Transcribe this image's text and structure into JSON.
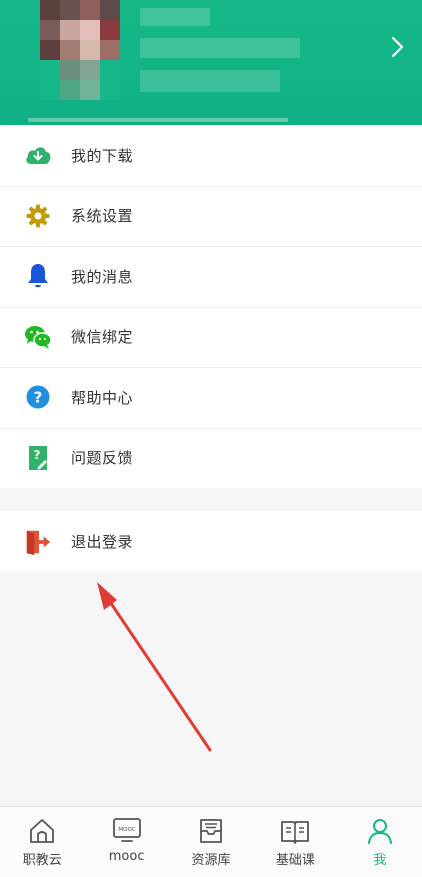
{
  "header": {
    "avatar_pixels": [
      "#5a3f3c",
      "#6a514f",
      "#8d5e5b",
      "#5f4a4a",
      "#7a5c58",
      "#c9a79f",
      "#e2bfb8",
      "#8a3b3e",
      "#5c3f3a",
      "#a07c73",
      "#d7b8ad",
      "#9c6e66",
      "#16b88a",
      "#6e8f7c",
      "#83a393",
      "#16b88a",
      "#16b88a",
      "#4fa687",
      "#72b39c",
      "#16b88a"
    ],
    "chevron_icon": "chevron-right-icon",
    "accent": "#12b886"
  },
  "menu": {
    "items": [
      {
        "icon": "cloud-download-icon",
        "label": "我的下载"
      },
      {
        "icon": "gear-icon",
        "label": "系统设置"
      },
      {
        "icon": "bell-icon",
        "label": "我的消息"
      },
      {
        "icon": "wechat-icon",
        "label": "微信绑定"
      },
      {
        "icon": "question-icon",
        "label": "帮助中心"
      },
      {
        "icon": "feedback-icon",
        "label": "问题反馈"
      }
    ],
    "logout": {
      "icon": "logout-icon",
      "label": "退出登录"
    }
  },
  "tabbar": {
    "tabs": [
      {
        "icon": "home-icon",
        "label": "职教云"
      },
      {
        "icon": "mooc-icon",
        "label": "mooc",
        "badge": "MOOC"
      },
      {
        "icon": "resource-icon",
        "label": "资源库"
      },
      {
        "icon": "book-icon",
        "label": "基础课"
      },
      {
        "icon": "user-icon",
        "label": "我",
        "active": true
      }
    ]
  }
}
